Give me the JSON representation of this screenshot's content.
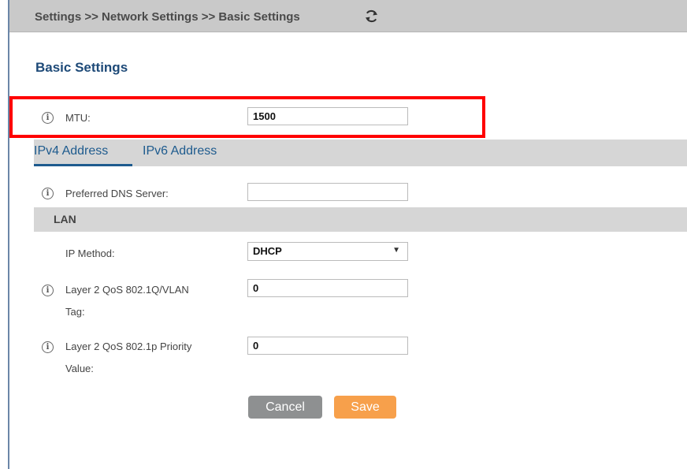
{
  "breadcrumb": "Settings >> Network Settings >> Basic Settings",
  "icons": {
    "refresh": "refresh-icon",
    "info": "info-icon",
    "dropdown": "chevron-down-icon"
  },
  "page_title": "Basic Settings",
  "mtu": {
    "label": "MTU:",
    "value": "1500"
  },
  "tabs": [
    {
      "label": "IPv4 Address",
      "active": true
    },
    {
      "label": "IPv6 Address",
      "active": false
    }
  ],
  "dns": {
    "label": "Preferred DNS Server:",
    "value": ""
  },
  "lan": {
    "title": "LAN",
    "ip_method": {
      "label": "IP Method:",
      "value": "DHCP"
    },
    "vlan_tag": {
      "label_line1": "Layer 2 QoS 802.1Q/VLAN",
      "label_line2": "Tag:",
      "value": "0"
    },
    "priority": {
      "label_line1": "Layer 2 QoS 802.1p Priority",
      "label_line2": "Value:",
      "value": "0"
    }
  },
  "buttons": {
    "cancel": "Cancel",
    "save": "Save"
  },
  "colors": {
    "title": "#1e4a78",
    "tab": "#1e5b8e",
    "highlight": "#ff0000",
    "save": "#f7a04b",
    "cancel": "#8e9091"
  }
}
